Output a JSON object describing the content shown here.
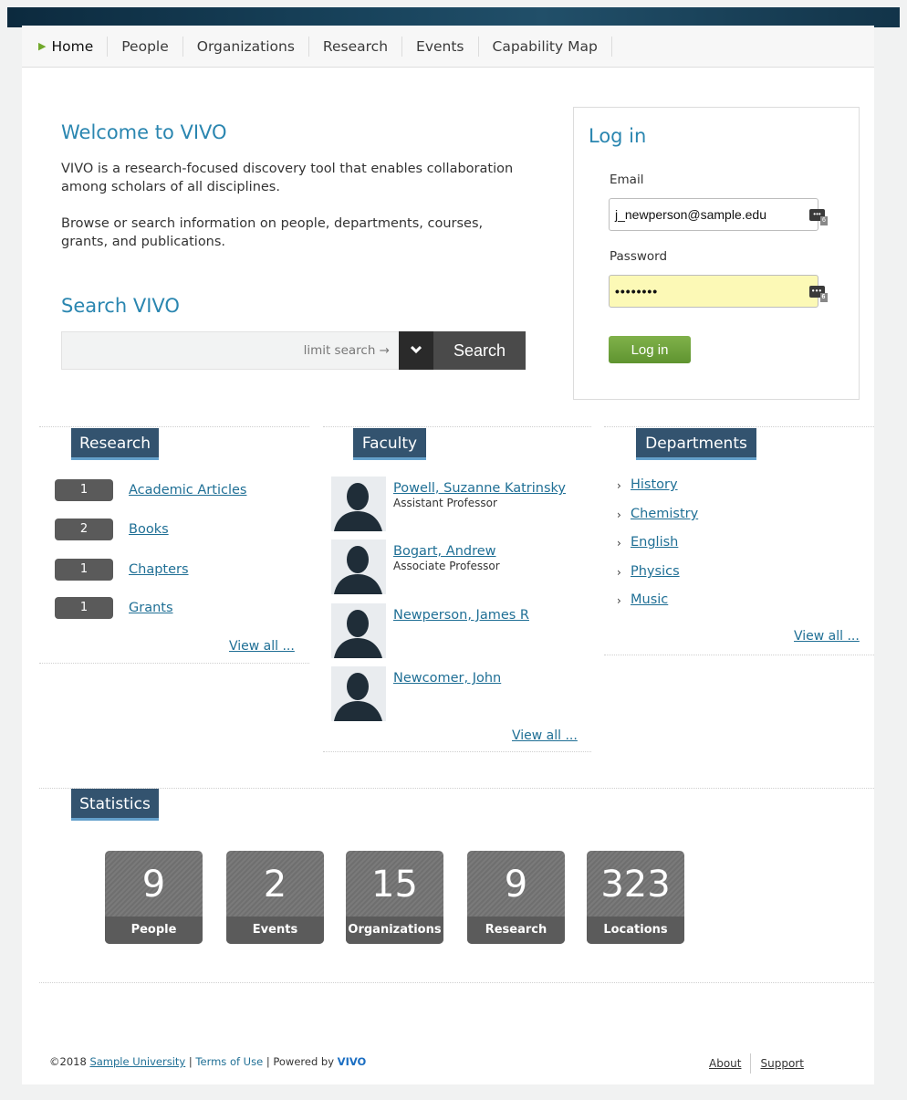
{
  "nav": {
    "items": [
      "Home",
      "People",
      "Organizations",
      "Research",
      "Events",
      "Capability Map"
    ]
  },
  "welcome": {
    "title": "Welcome to VIVO",
    "para1": "VIVO is a research-focused discovery tool that enables collaboration among scholars of all disciplines.",
    "para2": "Browse or search information on people, departments, courses, grants, and publications."
  },
  "search": {
    "title": "Search VIVO",
    "limit_label": "limit search →",
    "button_label": "Search"
  },
  "login": {
    "title": "Log in",
    "email_label": "Email",
    "email_value": "j_newperson@sample.edu",
    "password_label": "Password",
    "password_value": "••••••••",
    "button_label": "Log in",
    "manager_badge": "•••",
    "manager_count": "6"
  },
  "research": {
    "title": "Research",
    "items": [
      {
        "count": "1",
        "label": "Academic Articles"
      },
      {
        "count": "2",
        "label": "Books"
      },
      {
        "count": "1",
        "label": "Chapters"
      },
      {
        "count": "1",
        "label": "Grants"
      }
    ],
    "view_all": "View all ..."
  },
  "faculty": {
    "title": "Faculty",
    "people": [
      {
        "name": "Powell, Suzanne Katrinsky",
        "title": "Assistant Professor"
      },
      {
        "name": "Bogart, Andrew",
        "title": "Associate Professor"
      },
      {
        "name": "Newperson, James R",
        "title": ""
      },
      {
        "name": "Newcomer, John",
        "title": ""
      }
    ],
    "view_all": "View all ..."
  },
  "departments": {
    "title": "Departments",
    "items": [
      "History",
      "Chemistry",
      "English",
      "Physics",
      "Music"
    ],
    "view_all": "View all ..."
  },
  "statistics": {
    "title": "Statistics",
    "items": [
      {
        "value": "9",
        "label": "People"
      },
      {
        "value": "2",
        "label": "Events"
      },
      {
        "value": "15",
        "label": "Organizations"
      },
      {
        "value": "9",
        "label": "Research"
      },
      {
        "value": "323",
        "label": "Locations"
      }
    ]
  },
  "footer": {
    "copyright": "©2018",
    "university": "Sample University",
    "sep": "|",
    "terms": "Terms of Use",
    "powered": "Powered by",
    "vivo": "VIVO",
    "about": "About",
    "support": "Support"
  }
}
